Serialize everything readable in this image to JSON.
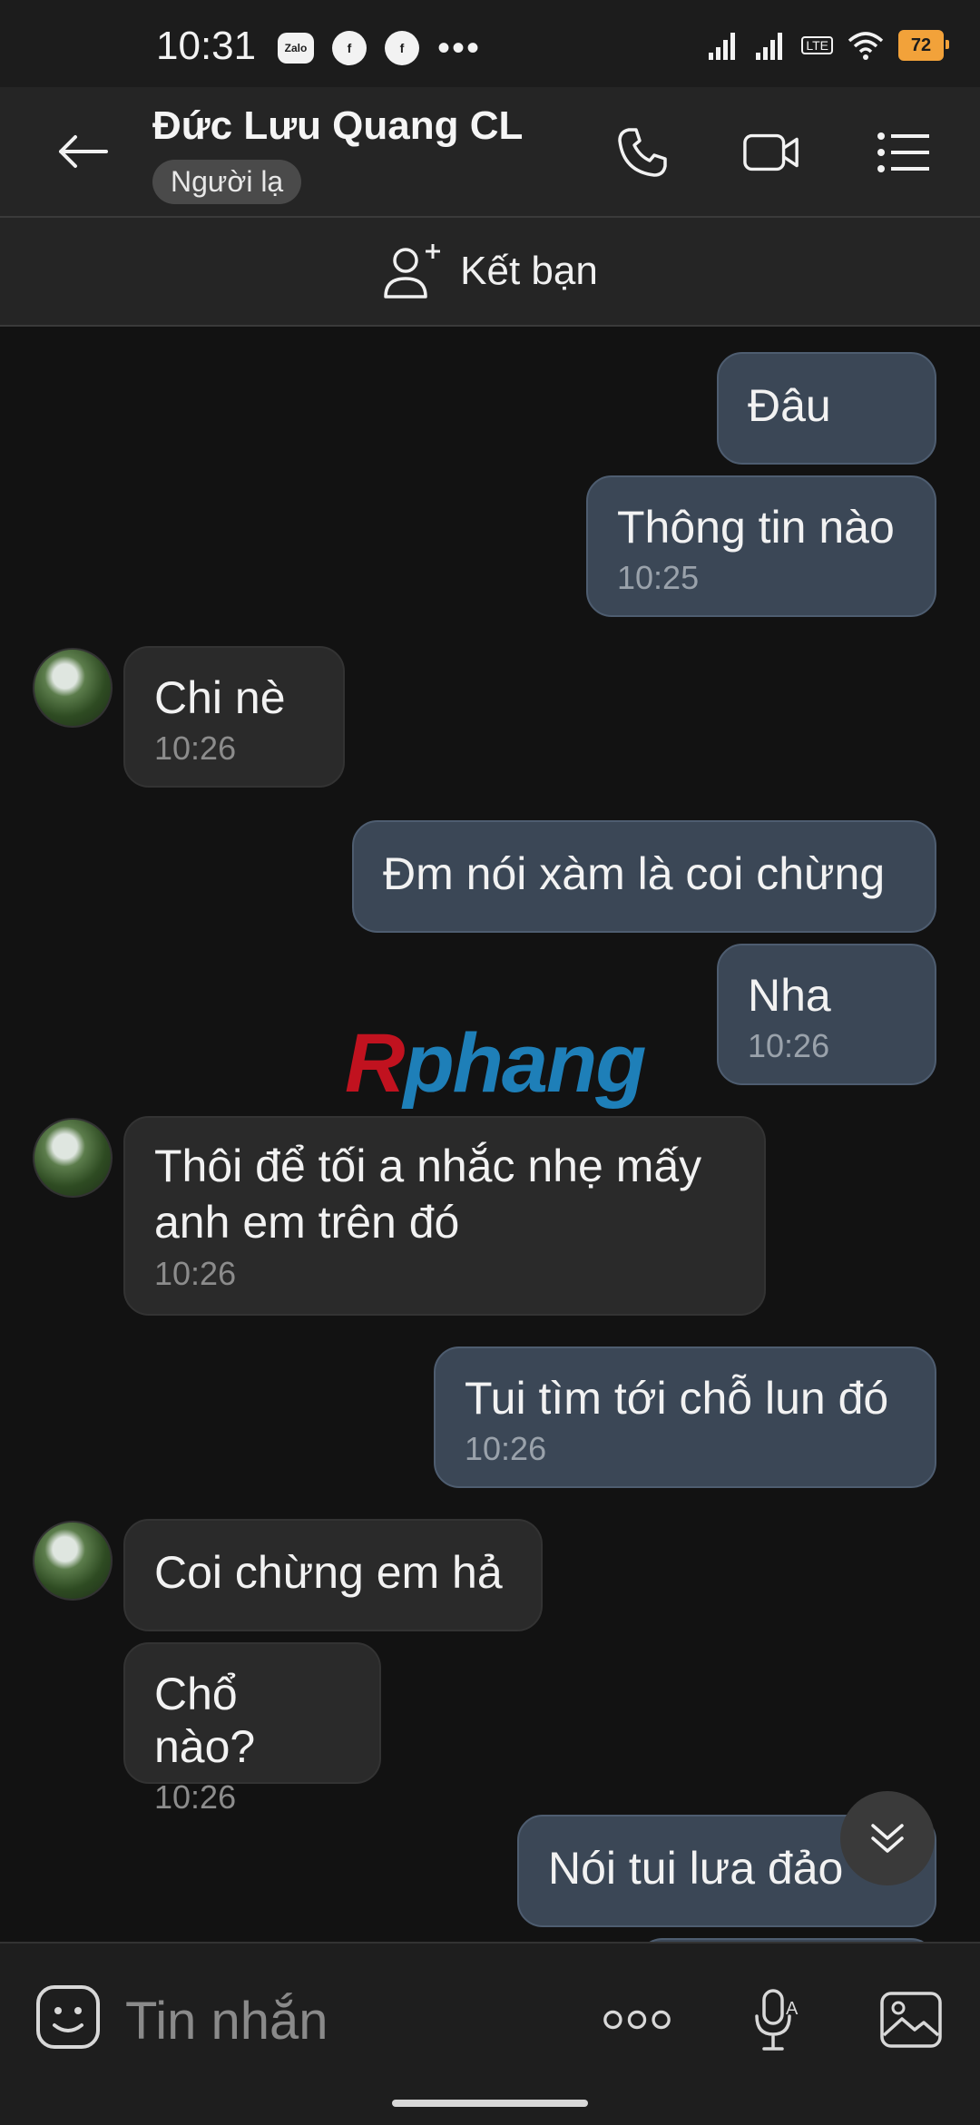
{
  "status_bar": {
    "time": "10:31",
    "app_icons": [
      "zalo-icon",
      "facebook-icon",
      "facebook-icon"
    ],
    "zalo_label": "Zalo",
    "more": "•••",
    "battery": "72",
    "network_label": "LTE"
  },
  "header": {
    "contact_name": "Đức Lưu Quang CL",
    "badge": "Người lạ"
  },
  "friend_bar": {
    "label": "Kết bạn"
  },
  "watermark": {
    "first": "R",
    "rest": "phang"
  },
  "messages": [
    {
      "side": "me",
      "text": "Đâu",
      "time": ""
    },
    {
      "side": "me",
      "text": "Thông tin nào",
      "time": "10:25"
    },
    {
      "side": "them",
      "text": "Chi nè",
      "time": "10:26"
    },
    {
      "side": "me",
      "text": "Đm nói xàm là coi chừng",
      "time": ""
    },
    {
      "side": "me",
      "text": "Nha",
      "time": "10:26"
    },
    {
      "side": "them",
      "text": "Thôi để tối a nhắc nhẹ mấy anh em trên đó",
      "time": "10:26"
    },
    {
      "side": "me",
      "text": "Tui tìm tới chỗ lun đó",
      "time": "10:26"
    },
    {
      "side": "them",
      "text": "Coi chừng em hả",
      "time": ""
    },
    {
      "side": "them",
      "text": "Chổ nào?",
      "time": "10:26"
    },
    {
      "side": "me",
      "text": "Nói tui lưa đảo",
      "time": ""
    }
  ],
  "input": {
    "placeholder": "Tin nhắn"
  },
  "colors": {
    "background": "#121212",
    "my_bubble": "#3b4756",
    "their_bubble": "#2a2a2a",
    "battery": "#f2a23a"
  }
}
